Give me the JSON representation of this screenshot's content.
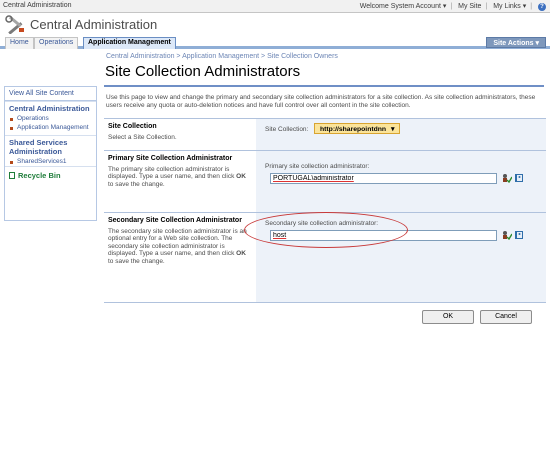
{
  "topbar": {
    "site_name": "Central Administration",
    "welcome": "Welcome System Account ▾",
    "my_site": "My Site",
    "my_links": "My Links ▾",
    "help_glyph": "?"
  },
  "header": {
    "app_title": "Central Administration",
    "logo_icon": "tools-icon"
  },
  "nav": {
    "tabs": [
      {
        "label": "Home",
        "active": false
      },
      {
        "label": "Operations",
        "active": false
      },
      {
        "label": "Application Management",
        "active": true
      }
    ],
    "site_actions": "Site Actions ▾"
  },
  "breadcrumb": "Central Administration > Application Management > Site Collection Owners",
  "page_title": "Site Collection Administrators",
  "sidebar": {
    "view_all": "View All Site Content",
    "central_admin": "Central Administration",
    "items": [
      "Operations",
      "Application Management"
    ],
    "shared_services": "Shared Services Administration",
    "ss_items": [
      "SharedServices1"
    ],
    "recycle_bin": "Recycle Bin"
  },
  "description": "Use this page to view and change the primary and secondary site collection administrators for a site collection. As site collection administrators, these users receive any quota or auto-deletion notices and have full control over all content in the site collection.",
  "sections": {
    "site_collection": {
      "label": "Site Collection",
      "help": "Select a Site Collection.",
      "field_label": "Site Collection:",
      "value": "http://sharepointdnn"
    },
    "primary": {
      "label": "Primary Site Collection Administrator",
      "help_prefix": "The primary site collection administrator is displayed. Type a user name, and then click ",
      "help_ok": "OK",
      "help_suffix": " to save the change.",
      "field_label": "Primary site collection administrator:",
      "value": "PORTUGAL\\administrator"
    },
    "secondary": {
      "label": "Secondary Site Collection Administrator",
      "help_prefix": "The secondary site collection administrator is an optional entry for a Web site collection. The secondary site collection administrator is displayed. Type a user name, and then click ",
      "help_ok": "OK",
      "help_suffix": " to save the change.",
      "field_label": "Secondary site collection administrator:",
      "value": "host"
    }
  },
  "buttons": {
    "ok": "OK",
    "cancel": "Cancel"
  },
  "colors": {
    "accent": "#6f8fc6",
    "highlight": "#c83a3a",
    "select_bg": "#fbe49a"
  }
}
